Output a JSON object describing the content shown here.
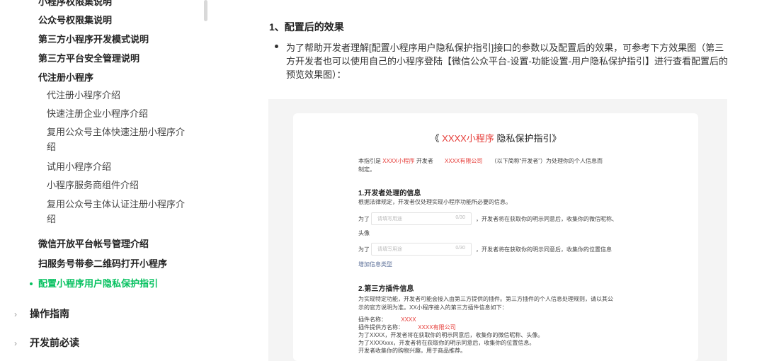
{
  "sidebar": {
    "items": [
      {
        "label": "小程序权限集说明"
      },
      {
        "label": "公众号权限集说明"
      },
      {
        "label": "第三方小程序开发模式说明"
      },
      {
        "label": "第三方平台安全管理说明"
      },
      {
        "label": "代注册小程序"
      },
      {
        "label": "代注册小程序介绍"
      },
      {
        "label": "快速注册企业小程序介绍"
      },
      {
        "label": "复用公众号主体快速注册小程序介绍"
      },
      {
        "label": "试用小程序介绍"
      },
      {
        "label": "小程序服务商组件介绍"
      },
      {
        "label": "复用公众号主体认证注册小程序介绍"
      },
      {
        "label": "微信开放平台帐号管理介绍"
      },
      {
        "label": "扫服务号带参二维码打开小程序"
      },
      {
        "label": "配置小程序用户隐私保护指引"
      }
    ],
    "sections": [
      {
        "label": "操作指南"
      },
      {
        "label": "开发前必读"
      }
    ]
  },
  "main": {
    "heading": "1、配置后的效果",
    "paragraph": "为了帮助开发者理解[配置小程序用户隐私保护指引]接口的参数以及配置后的效果，可参考下方效果图（第三方开发者也可以使用自己的小程序登陆【微信公众平台-设置-功能设置-用户隐私保护指引】进行查看配置后的预览效果图）："
  },
  "preview": {
    "title_open": "《",
    "title_app": "XXXX小程序",
    "title_rest": "隐私保护指引》",
    "intro_a": "本指引是",
    "intro_app": "XXXX小程序",
    "intro_b": "开发者",
    "intro_company": "XXXX有限公司",
    "intro_c": "（以下简称“开发者”）为处理你的个人信息而",
    "intro_d": "制定。",
    "sec1": "1.开发者处理的信息",
    "sec1_desc": "根据法律规定，开发者仅处理实现小程序功能所必要的信息。",
    "for_label": "为了",
    "input_placeholder": "请填写用途",
    "input_count": "0/30",
    "row1_text": "，开发者将在获取你的明示同意后，收集你的微信昵称、",
    "row1_cont": "头像",
    "row2_text": "，开发者将在获取你的明示同意后，收集你的位置信息",
    "add_type": "增加信息类型",
    "sec2": "2.第三方插件信息",
    "sec2_desc1": "为实现特定功能，开发者可能会接入由第三方提供的插件。第三方插件的个人信息处理规则，请以其公",
    "sec2_desc2": "示的官方说明为准。XX小程序接入的第三方插件信息如下：",
    "plugin_name_label": "插件名称：",
    "plugin_name": "XXXX",
    "plugin_provider_label": "插件提供方名称：",
    "plugin_provider": "XXXX有限公司",
    "plugin_line1": "为了XXXX，开发者将在获取你的明示同意后，收集你的微信昵称、头像。",
    "plugin_line2": "为了XXXXxxx，开发者将在获取你的明示同意后，收集你的位置信息。",
    "plugin_line3": "开发者收集你的购物兴趣，用于商品推荐。"
  }
}
